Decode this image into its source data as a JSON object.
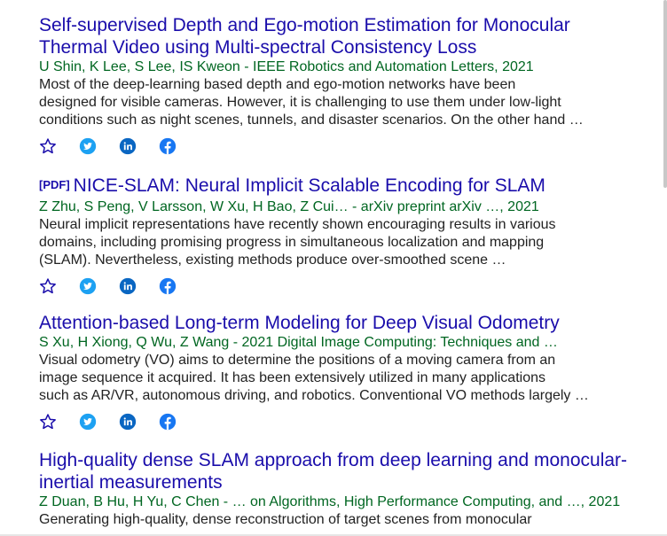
{
  "results": [
    {
      "pdf": "",
      "title_lines": [
        "Self-supervised Depth and Ego-motion Estimation for Monocular",
        "Thermal Video using Multi-spectral Consistency Loss"
      ],
      "authors": "U Shin, K Lee, S Lee, IS Kweon - IEEE Robotics and Automation Letters, 2021",
      "snippet_lines": [
        "Most of the deep-learning based depth and ego-motion networks have been",
        "designed for visible cameras. However, it is challenging to use them under low-light",
        "conditions such as night scenes, tunnels, and disaster scenarios. On the other hand …"
      ]
    },
    {
      "pdf": "[PDF]",
      "title_lines": [
        "NICE-SLAM: Neural Implicit Scalable Encoding for SLAM"
      ],
      "authors": "Z Zhu, S Peng, V Larsson, W Xu, H Bao, Z Cui… - arXiv preprint arXiv …, 2021",
      "snippet_lines": [
        "Neural implicit representations have recently shown encouraging results in various",
        "domains, including promising progress in simultaneous localization and mapping",
        "(SLAM). Nevertheless, existing methods produce over-smoothed scene …"
      ]
    },
    {
      "pdf": "",
      "title_lines": [
        "Attention-based Long-term Modeling for Deep Visual Odometry"
      ],
      "authors": "S Xu, H Xiong, Q Wu, Z Wang - 2021 Digital Image Computing: Techniques and …",
      "snippet_lines": [
        "Visual odometry (VO) aims to determine the positions of a moving camera from an",
        "image sequence it acquired. It has been extensively utilized in many applications",
        "such as AR/VR, autonomous driving, and robotics. Conventional VO methods largely …"
      ]
    },
    {
      "pdf": "",
      "title_lines": [
        "High-quality dense SLAM approach from deep learning and monocular-",
        "inertial measurements"
      ],
      "authors": "Z Duan, B Hu, H Yu, C Chen - … on Algorithms, High Performance Computing, and …, 2021",
      "snippet_lines": [
        "Generating high-quality, dense reconstruction of target scenes from monocular"
      ]
    }
  ],
  "action_icons": [
    "star-icon",
    "twitter-icon",
    "linkedin-icon",
    "facebook-icon"
  ],
  "colors": {
    "title": "#1a0dab",
    "authors": "#006621",
    "snippet": "#222222",
    "star": "#1a0dab",
    "twitter": "#1da1f2",
    "linkedin": "#0a66c2",
    "facebook": "#1877f2"
  }
}
